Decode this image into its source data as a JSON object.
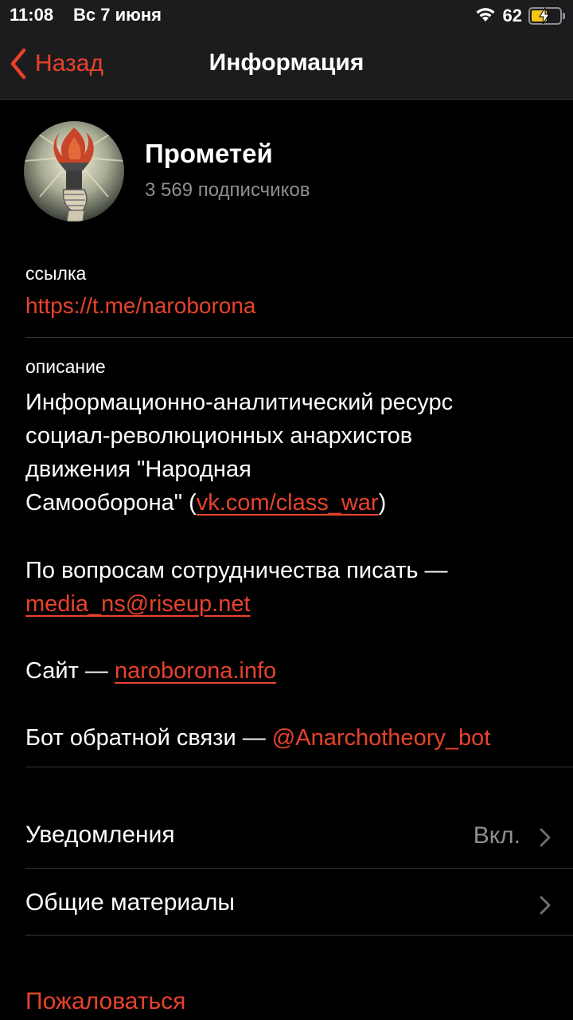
{
  "status_bar": {
    "time": "11:08",
    "date": "Вс 7 июня",
    "battery_percent": "62",
    "battery_level": 0.62,
    "charging": true
  },
  "nav": {
    "back_label": "Назад",
    "title": "Информация"
  },
  "channel": {
    "name": "Прометей",
    "subscribers": "3 569 подписчиков",
    "avatar_icon": "torch-avatar"
  },
  "link_section": {
    "label": "ссылка",
    "value": "https://t.me/naroborona"
  },
  "description": {
    "label": "описание",
    "line1": "Информационно-аналитический ресурс",
    "line2": "социал-революционных анархистов",
    "line3": "движения \"Народная",
    "line4_pre": "Самооборона\" (",
    "line4_link": "vk.com/class_war",
    "line4_post": ")",
    "para2_text": "По вопросам сотрудничества писать —",
    "para2_link": "media_ns@riseup.net",
    "para3_text": "Сайт — ",
    "para3_link": "naroborona.info",
    "para4_text": "Бот обратной связи — ",
    "para4_link": "@Anarchotheory_bot"
  },
  "rows": [
    {
      "label": "Уведомления",
      "value": "Вкл."
    },
    {
      "label": "Общие материалы",
      "value": ""
    }
  ],
  "report_label": "Пожаловаться",
  "colors": {
    "accent": "#e7422c",
    "background": "#000000",
    "bar": "#1c1c1e",
    "secondary_text": "#8e8e93",
    "separator": "#38383a"
  }
}
